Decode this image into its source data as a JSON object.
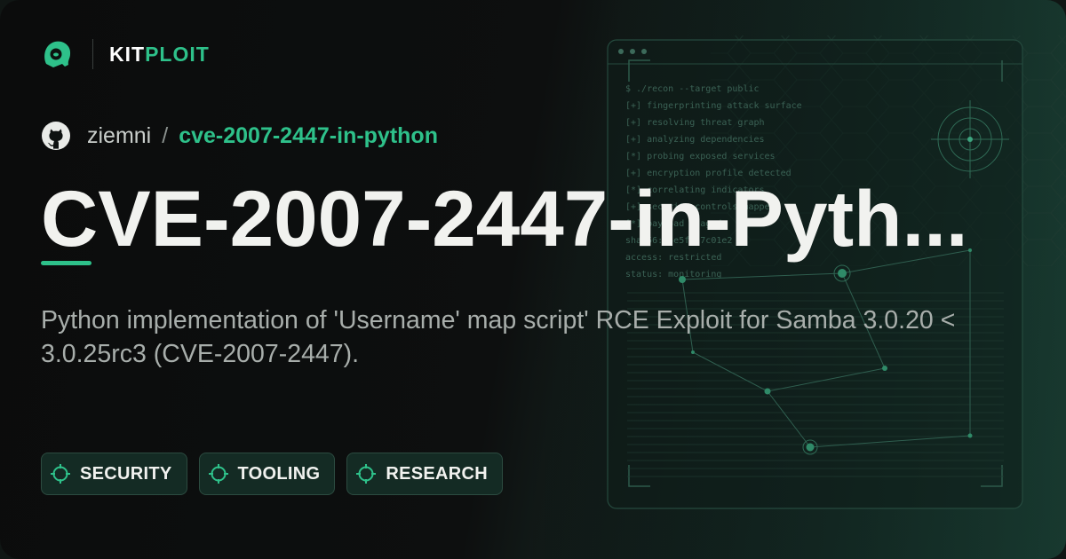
{
  "brand": {
    "name_part1": "KIT",
    "name_part2": "PLOIT",
    "logo_icon": "hacker-head-icon"
  },
  "repo": {
    "owner": "ziemni",
    "separator": "/",
    "name": "cve-2007-2447-in-python",
    "icon": "github-icon"
  },
  "title": "CVE-2007-2447-in-Pyth...",
  "description": "Python implementation of 'Username' map script' RCE Exploit for Samba 3.0.20 < 3.0.25rc3 (CVE-2007-2447).",
  "tags": [
    {
      "label": "SECURITY",
      "icon": "crosshair-icon"
    },
    {
      "label": "TOOLING",
      "icon": "crosshair-icon"
    },
    {
      "label": "RESEARCH",
      "icon": "crosshair-icon"
    }
  ],
  "terminal": {
    "lines": [
      "$ ./recon --target public",
      "[+] fingerprinting attack surface",
      "[+] resolving threat graph",
      "[+] analyzing dependencies",
      "[*] probing exposed services",
      "[+] encryption profile detected",
      "[*] correlating indicators",
      "[+] security controls mapped",
      "[*] payload staged",
      "sha256: 4e5f3a7c01e2",
      "access: restricted",
      "status: monitoring"
    ]
  },
  "colors": {
    "accent": "#2ec18a",
    "background": "#0b0c0c",
    "title": "#f1f2ef"
  }
}
